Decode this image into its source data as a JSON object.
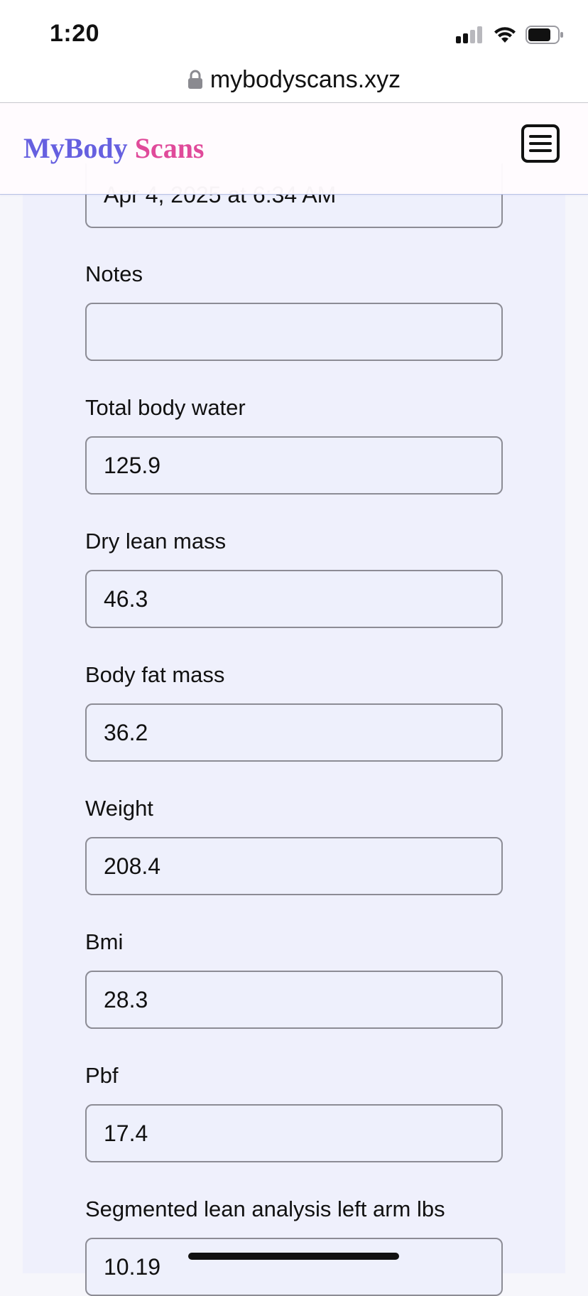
{
  "status_bar": {
    "time": "1:20",
    "icons": [
      "signal-icon",
      "wifi-icon",
      "battery-icon"
    ]
  },
  "browser": {
    "url": "mybodyscans.xyz",
    "lock_icon": "lock-icon"
  },
  "header": {
    "brand_part1": "MyBody",
    "brand_part2": "Scans",
    "menu_icon": "hamburger-menu-icon",
    "colors": {
      "brand_part1": "#6660e0",
      "brand_part2": "#e04a9a"
    }
  },
  "form": {
    "date_value": "Apr 4, 2025 at 6:34 AM",
    "fields": [
      {
        "label": "Notes",
        "value": ""
      },
      {
        "label": "Total body water",
        "value": "125.9"
      },
      {
        "label": "Dry lean mass",
        "value": "46.3"
      },
      {
        "label": "Body fat mass",
        "value": "36.2"
      },
      {
        "label": "Weight",
        "value": "208.4"
      },
      {
        "label": "Bmi",
        "value": "28.3"
      },
      {
        "label": "Pbf",
        "value": "17.4"
      },
      {
        "label": "Segmented lean analysis left arm lbs",
        "value": "10.19"
      }
    ]
  }
}
